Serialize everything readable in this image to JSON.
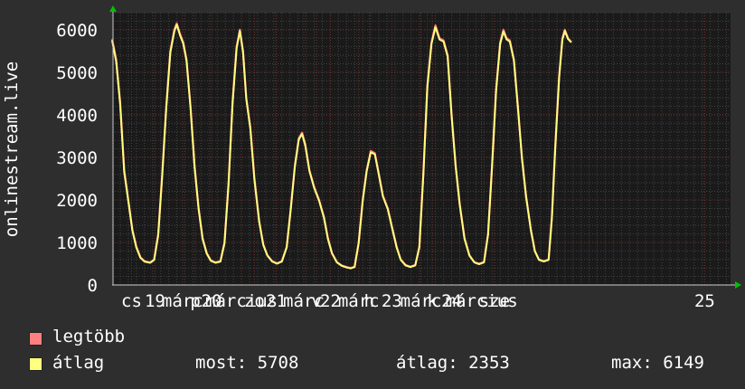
{
  "chart_data": {
    "type": "line",
    "ylabel": "onlinestream.live",
    "ylim": [
      0,
      6400
    ],
    "yticks": [
      0,
      1000,
      2000,
      3000,
      4000,
      5000,
      6000
    ],
    "xlim": [
      0,
      7.65
    ],
    "xtick_labels": [
      {
        "x": 0.24,
        "text": "cs"
      },
      {
        "x": 0.53,
        "text": "19"
      },
      {
        "x": 0.87,
        "text": "márc"
      },
      {
        "x": 1.03,
        "text": "p"
      },
      {
        "x": 1.23,
        "text": "20"
      },
      {
        "x": 1.6,
        "text": "március"
      },
      {
        "x": 1.76,
        "text": "zo"
      },
      {
        "x": 2.03,
        "text": "21"
      },
      {
        "x": 2.37,
        "text": "márc"
      },
      {
        "x": 2.53,
        "text": "v"
      },
      {
        "x": 2.7,
        "text": "22"
      },
      {
        "x": 3.05,
        "text": "márc"
      },
      {
        "x": 3.18,
        "text": "h"
      },
      {
        "x": 3.46,
        "text": "23"
      },
      {
        "x": 3.82,
        "text": "márc"
      },
      {
        "x": 3.96,
        "text": "k"
      },
      {
        "x": 4.2,
        "text": "24"
      },
      {
        "x": 4.57,
        "text": "március"
      },
      {
        "x": 4.73,
        "text": "sze"
      },
      {
        "x": 7.33,
        "text": "25"
      }
    ],
    "grid": true,
    "series": [
      {
        "name": "legtöbb",
        "color": "#ff7070",
        "points": [
          [
            0,
            5780
          ],
          [
            0.05,
            5300
          ],
          [
            0.1,
            4300
          ],
          [
            0.15,
            2700
          ],
          [
            0.2,
            2000
          ],
          [
            0.25,
            1300
          ],
          [
            0.3,
            900
          ],
          [
            0.35,
            650
          ],
          [
            0.4,
            560
          ],
          [
            0.47,
            530
          ],
          [
            0.52,
            600
          ],
          [
            0.57,
            1200
          ],
          [
            0.62,
            2600
          ],
          [
            0.67,
            4200
          ],
          [
            0.72,
            5500
          ],
          [
            0.77,
            6000
          ],
          [
            0.8,
            6149
          ],
          [
            0.84,
            5900
          ],
          [
            0.88,
            5700
          ],
          [
            0.92,
            5300
          ],
          [
            0.97,
            4200
          ],
          [
            1.02,
            2800
          ],
          [
            1.07,
            1800
          ],
          [
            1.12,
            1100
          ],
          [
            1.17,
            750
          ],
          [
            1.22,
            580
          ],
          [
            1.28,
            530
          ],
          [
            1.34,
            560
          ],
          [
            1.39,
            1000
          ],
          [
            1.44,
            2400
          ],
          [
            1.49,
            4300
          ],
          [
            1.54,
            5600
          ],
          [
            1.58,
            6000
          ],
          [
            1.62,
            5500
          ],
          [
            1.66,
            4400
          ],
          [
            1.71,
            3700
          ],
          [
            1.76,
            2500
          ],
          [
            1.82,
            1500
          ],
          [
            1.87,
            950
          ],
          [
            1.92,
            700
          ],
          [
            1.98,
            560
          ],
          [
            2.04,
            510
          ],
          [
            2.1,
            560
          ],
          [
            2.16,
            900
          ],
          [
            2.21,
            1800
          ],
          [
            2.26,
            2800
          ],
          [
            2.31,
            3450
          ],
          [
            2.35,
            3580
          ],
          [
            2.39,
            3300
          ],
          [
            2.44,
            2700
          ],
          [
            2.5,
            2300
          ],
          [
            2.56,
            2000
          ],
          [
            2.62,
            1600
          ],
          [
            2.67,
            1100
          ],
          [
            2.72,
            750
          ],
          [
            2.78,
            540
          ],
          [
            2.84,
            460
          ],
          [
            2.9,
            420
          ],
          [
            2.95,
            400
          ],
          [
            3.0,
            430
          ],
          [
            3.05,
            1000
          ],
          [
            3.1,
            2000
          ],
          [
            3.15,
            2700
          ],
          [
            3.2,
            3150
          ],
          [
            3.25,
            3100
          ],
          [
            3.3,
            2600
          ],
          [
            3.35,
            2100
          ],
          [
            3.41,
            1800
          ],
          [
            3.47,
            1300
          ],
          [
            3.52,
            900
          ],
          [
            3.57,
            600
          ],
          [
            3.63,
            470
          ],
          [
            3.69,
            430
          ],
          [
            3.75,
            470
          ],
          [
            3.8,
            900
          ],
          [
            3.85,
            2600
          ],
          [
            3.9,
            4700
          ],
          [
            3.95,
            5700
          ],
          [
            4.0,
            6100
          ],
          [
            4.05,
            5800
          ],
          [
            4.1,
            5750
          ],
          [
            4.15,
            5400
          ],
          [
            4.2,
            4000
          ],
          [
            4.25,
            2800
          ],
          [
            4.3,
            1900
          ],
          [
            4.36,
            1100
          ],
          [
            4.42,
            700
          ],
          [
            4.48,
            540
          ],
          [
            4.54,
            500
          ],
          [
            4.6,
            540
          ],
          [
            4.65,
            1200
          ],
          [
            4.7,
            2800
          ],
          [
            4.75,
            4600
          ],
          [
            4.8,
            5700
          ],
          [
            4.84,
            6000
          ],
          [
            4.88,
            5800
          ],
          [
            4.92,
            5750
          ],
          [
            4.97,
            5300
          ],
          [
            5.02,
            4200
          ],
          [
            5.07,
            3000
          ],
          [
            5.12,
            2100
          ],
          [
            5.18,
            1300
          ],
          [
            5.23,
            800
          ],
          [
            5.28,
            600
          ],
          [
            5.34,
            560
          ],
          [
            5.4,
            600
          ],
          [
            5.44,
            1600
          ],
          [
            5.48,
            3200
          ],
          [
            5.53,
            4900
          ],
          [
            5.57,
            5800
          ],
          [
            5.6,
            6000
          ],
          [
            5.64,
            5800
          ],
          [
            5.68,
            5708
          ]
        ]
      },
      {
        "name": "átlag",
        "color": "#ffff80",
        "points": [
          [
            0,
            5750
          ],
          [
            0.05,
            5250
          ],
          [
            0.1,
            4250
          ],
          [
            0.15,
            2650
          ],
          [
            0.2,
            1970
          ],
          [
            0.25,
            1280
          ],
          [
            0.3,
            880
          ],
          [
            0.35,
            640
          ],
          [
            0.4,
            550
          ],
          [
            0.47,
            520
          ],
          [
            0.52,
            590
          ],
          [
            0.57,
            1170
          ],
          [
            0.62,
            2560
          ],
          [
            0.67,
            4160
          ],
          [
            0.72,
            5460
          ],
          [
            0.77,
            5960
          ],
          [
            0.8,
            6120
          ],
          [
            0.84,
            5870
          ],
          [
            0.88,
            5670
          ],
          [
            0.92,
            5270
          ],
          [
            0.97,
            4170
          ],
          [
            1.02,
            2770
          ],
          [
            1.07,
            1780
          ],
          [
            1.12,
            1080
          ],
          [
            1.17,
            740
          ],
          [
            1.22,
            570
          ],
          [
            1.28,
            520
          ],
          [
            1.34,
            550
          ],
          [
            1.39,
            980
          ],
          [
            1.44,
            2370
          ],
          [
            1.49,
            4260
          ],
          [
            1.54,
            5560
          ],
          [
            1.58,
            5970
          ],
          [
            1.62,
            5470
          ],
          [
            1.66,
            4370
          ],
          [
            1.71,
            3670
          ],
          [
            1.76,
            2470
          ],
          [
            1.82,
            1480
          ],
          [
            1.87,
            940
          ],
          [
            1.92,
            690
          ],
          [
            1.98,
            550
          ],
          [
            2.04,
            500
          ],
          [
            2.1,
            550
          ],
          [
            2.16,
            880
          ],
          [
            2.21,
            1780
          ],
          [
            2.26,
            2780
          ],
          [
            2.31,
            3420
          ],
          [
            2.35,
            3550
          ],
          [
            2.39,
            3270
          ],
          [
            2.44,
            2680
          ],
          [
            2.5,
            2280
          ],
          [
            2.56,
            1980
          ],
          [
            2.62,
            1580
          ],
          [
            2.67,
            1080
          ],
          [
            2.72,
            740
          ],
          [
            2.78,
            530
          ],
          [
            2.84,
            450
          ],
          [
            2.9,
            410
          ],
          [
            2.95,
            390
          ],
          [
            3.0,
            420
          ],
          [
            3.05,
            980
          ],
          [
            3.1,
            1980
          ],
          [
            3.15,
            2680
          ],
          [
            3.2,
            3120
          ],
          [
            3.25,
            3070
          ],
          [
            3.3,
            2580
          ],
          [
            3.35,
            2080
          ],
          [
            3.41,
            1780
          ],
          [
            3.47,
            1280
          ],
          [
            3.52,
            880
          ],
          [
            3.57,
            590
          ],
          [
            3.63,
            460
          ],
          [
            3.69,
            420
          ],
          [
            3.75,
            460
          ],
          [
            3.8,
            880
          ],
          [
            3.85,
            2570
          ],
          [
            3.9,
            4660
          ],
          [
            3.95,
            5660
          ],
          [
            4.0,
            6060
          ],
          [
            4.05,
            5770
          ],
          [
            4.1,
            5720
          ],
          [
            4.15,
            5370
          ],
          [
            4.2,
            3970
          ],
          [
            4.25,
            2780
          ],
          [
            4.3,
            1880
          ],
          [
            4.36,
            1080
          ],
          [
            4.42,
            690
          ],
          [
            4.48,
            530
          ],
          [
            4.54,
            490
          ],
          [
            4.6,
            530
          ],
          [
            4.65,
            1180
          ],
          [
            4.7,
            2770
          ],
          [
            4.75,
            4560
          ],
          [
            4.8,
            5660
          ],
          [
            4.84,
            5960
          ],
          [
            4.88,
            5770
          ],
          [
            4.92,
            5720
          ],
          [
            4.97,
            5270
          ],
          [
            5.02,
            4170
          ],
          [
            5.07,
            2970
          ],
          [
            5.12,
            2080
          ],
          [
            5.18,
            1280
          ],
          [
            5.23,
            790
          ],
          [
            5.28,
            590
          ],
          [
            5.34,
            550
          ],
          [
            5.4,
            590
          ],
          [
            5.44,
            1570
          ],
          [
            5.48,
            3170
          ],
          [
            5.53,
            4860
          ],
          [
            5.57,
            5760
          ],
          [
            5.6,
            5970
          ],
          [
            5.64,
            5780
          ],
          [
            5.68,
            5700
          ]
        ]
      }
    ]
  },
  "legend": {
    "max_label": "legtöbb",
    "avg_label": "átlag",
    "max_color": "#ff8080",
    "avg_color": "#ffff80"
  },
  "stats": {
    "now": "most: 5708",
    "avg": "átlag: 2353",
    "max": "max: 6149"
  },
  "colors": {
    "background": "#2e2e2e",
    "plot_background": "#1a1a1a",
    "grid_major": "#7a3030",
    "grid_minor": "#444444",
    "text": "#ffffff",
    "axis_arrow": "#00c000"
  }
}
